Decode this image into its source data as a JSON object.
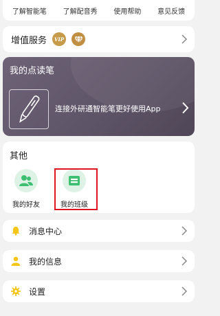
{
  "top_links": [
    {
      "label": "了解智能笔"
    },
    {
      "label": "了解配音秀"
    },
    {
      "label": "使用帮助"
    },
    {
      "label": "意见反馈"
    }
  ],
  "vip": {
    "title": "增值服务",
    "badges": [
      {
        "icon": "vip-badge-icon",
        "label": "VIP"
      },
      {
        "icon": "diamond-badge-icon"
      }
    ]
  },
  "pen_card": {
    "title": "我的点读笔",
    "description": "连接外研通智能笔更好使用App",
    "icon": "smart-pen-icon"
  },
  "others": {
    "title": "其他",
    "items": [
      {
        "label": "我的好友",
        "icon": "friends-icon"
      },
      {
        "label": "我的班级",
        "icon": "class-icon"
      }
    ]
  },
  "list": [
    {
      "label": "消息中心",
      "icon": "bell-icon"
    },
    {
      "label": "我的信息",
      "icon": "user-icon"
    },
    {
      "label": "设置",
      "icon": "gear-icon"
    }
  ],
  "colors": {
    "accent_green": "#3fbf72",
    "icon_yellow": "#f5c518",
    "highlight_red": "#e0141e",
    "pen_card_bg": "#5d5366"
  }
}
